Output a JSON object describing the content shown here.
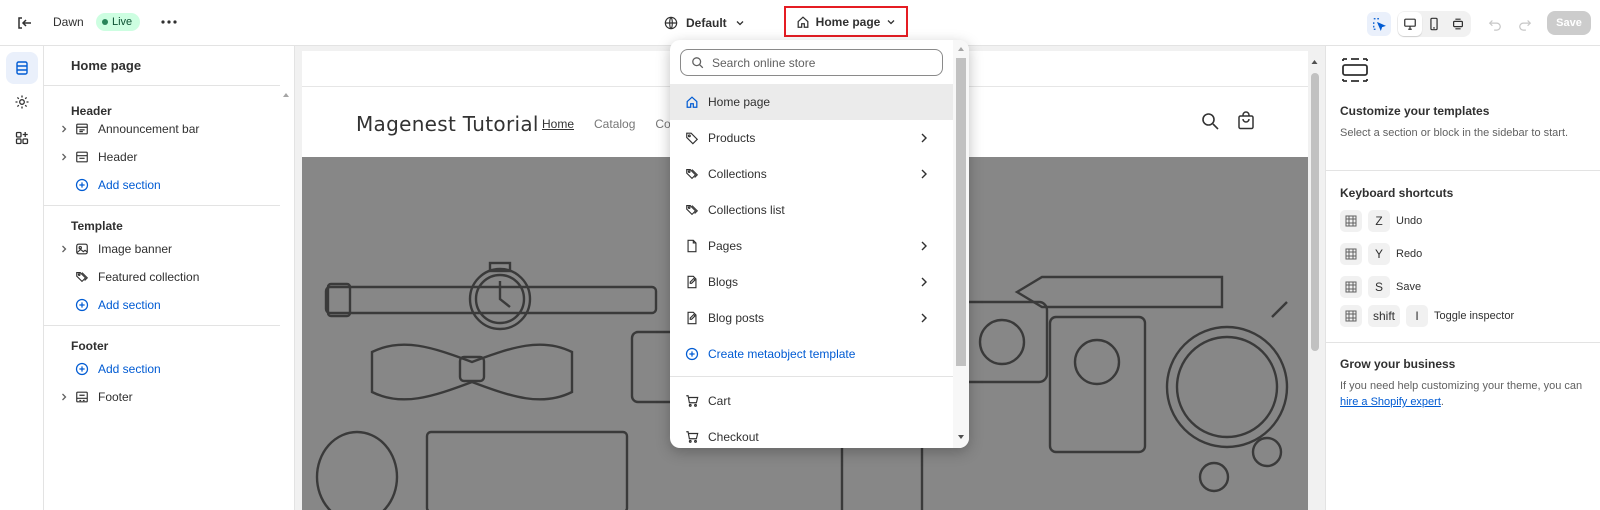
{
  "topbar": {
    "theme_name": "Dawn",
    "status_badge": "Live",
    "template_selector": "Default",
    "page_selector": "Home page",
    "save_label": "Save"
  },
  "sidebar": {
    "title": "Home page",
    "header_group": {
      "heading": "Header",
      "items": [
        "Announcement bar",
        "Header"
      ],
      "add_label": "Add section"
    },
    "template_group": {
      "heading": "Template",
      "items": [
        "Image banner",
        "Featured collection"
      ],
      "add_label": "Add section"
    },
    "footer_group": {
      "heading": "Footer",
      "add_label": "Add section",
      "items": [
        "Footer"
      ]
    }
  },
  "preview": {
    "store_name": "Magenest Tutorial",
    "nav": [
      "Home",
      "Catalog",
      "Conta"
    ]
  },
  "dropdown": {
    "search_placeholder": "Search online store",
    "items": [
      {
        "label": "Home page",
        "icon": "home-icon"
      },
      {
        "label": "Products",
        "icon": "tag-icon"
      },
      {
        "label": "Collections",
        "icon": "tags-icon"
      },
      {
        "label": "Collections list",
        "icon": "tags-icon"
      },
      {
        "label": "Pages",
        "icon": "page-icon"
      },
      {
        "label": "Blogs",
        "icon": "blog-icon"
      },
      {
        "label": "Blog posts",
        "icon": "blog-icon"
      },
      {
        "label": "Create metaobject template",
        "icon": "plus-circle-icon"
      },
      {
        "label": "Cart",
        "icon": "cart-icon"
      },
      {
        "label": "Checkout",
        "icon": "cart-icon"
      }
    ]
  },
  "right_panel": {
    "customize_title": "Customize your templates",
    "customize_text": "Select a section or block in the sidebar to start.",
    "shortcuts_title": "Keyboard shortcuts",
    "shortcuts": [
      {
        "key": "Z",
        "label": "Undo"
      },
      {
        "key": "Y",
        "label": "Redo"
      },
      {
        "key": "S",
        "label": "Save"
      },
      {
        "key": "shift",
        "key2": "I",
        "label": "Toggle inspector"
      }
    ],
    "grow_title": "Grow your business",
    "grow_text": "If you need help customizing your theme, you can",
    "grow_link": "hire a Shopify expert",
    "grow_end": "."
  },
  "colors": {
    "accent": "#005bd3",
    "highlight_box": "#e51c23",
    "live_badge_bg": "#cdfee1"
  }
}
